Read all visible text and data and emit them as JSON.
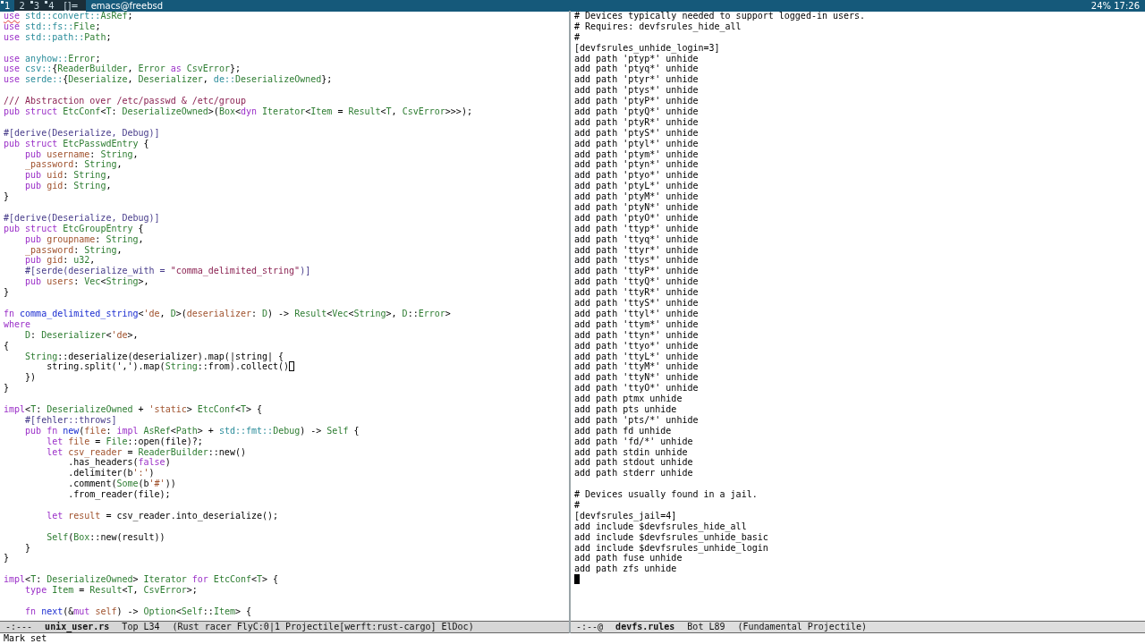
{
  "top_bar": {
    "tags": [
      {
        "label": "1",
        "selected": true,
        "occupied": true
      },
      {
        "label": "2",
        "selected": false,
        "occupied": false
      },
      {
        "label": "3",
        "selected": false,
        "occupied": true
      },
      {
        "label": "4",
        "selected": false,
        "occupied": true
      }
    ],
    "layout": "[]=",
    "window_title": "emacs@freebsd",
    "status": "24% 17:26"
  },
  "left_pane": {
    "active": false,
    "blocks": [
      [
        [
          {
            "kind": "flagged",
            "text": "use"
          },
          {
            "kind": "path",
            "text": " std::convert::"
          },
          {
            "kind": "type",
            "text": "AsRef"
          },
          {
            "kind": "plain",
            "text": ";"
          }
        ],
        [
          {
            "kind": "keyword",
            "text": "use "
          },
          {
            "kind": "path",
            "text": "std::fs::"
          },
          {
            "kind": "type",
            "text": "File"
          },
          {
            "kind": "plain",
            "text": ";"
          }
        ],
        [
          {
            "kind": "keyword",
            "text": "use "
          },
          {
            "kind": "path",
            "text": "std::path::"
          },
          {
            "kind": "type",
            "text": "Path"
          },
          {
            "kind": "plain",
            "text": ";"
          }
        ]
      ],
      [
        [
          {
            "kind": "keyword",
            "text": "use "
          },
          {
            "kind": "path",
            "text": "anyhow::"
          },
          {
            "kind": "type",
            "text": "Error"
          },
          {
            "kind": "plain",
            "text": ";"
          }
        ],
        [
          {
            "kind": "keyword",
            "text": "use "
          },
          {
            "kind": "path",
            "text": "csv::"
          },
          {
            "kind": "plain",
            "text": "{"
          },
          {
            "kind": "type",
            "text": "ReaderBuilder"
          },
          {
            "kind": "plain",
            "text": ", "
          },
          {
            "kind": "type",
            "text": "Error"
          },
          {
            "kind": "keyword",
            "text": " as "
          },
          {
            "kind": "type",
            "text": "CsvError"
          },
          {
            "kind": "plain",
            "text": "};"
          }
        ],
        [
          {
            "kind": "keyword",
            "text": "use "
          },
          {
            "kind": "path",
            "text": "serde::"
          },
          {
            "kind": "plain",
            "text": "{"
          },
          {
            "kind": "type",
            "text": "Deserialize"
          },
          {
            "kind": "plain",
            "text": ", "
          },
          {
            "kind": "type",
            "text": "Deserializer"
          },
          {
            "kind": "plain",
            "text": ", "
          },
          {
            "kind": "path",
            "text": "de::"
          },
          {
            "kind": "type",
            "text": "DeserializeOwned"
          },
          {
            "kind": "plain",
            "text": "};"
          }
        ]
      ],
      [
        [
          {
            "kind": "comment",
            "text": "/// Abstraction over /etc/passwd & /etc/group"
          }
        ],
        [
          {
            "kind": "keyword",
            "text": "pub struct "
          },
          {
            "kind": "type",
            "text": "EtcConf"
          },
          {
            "kind": "plain",
            "text": "<"
          },
          {
            "kind": "type",
            "text": "T"
          },
          {
            "kind": "plain",
            "text": ": "
          },
          {
            "kind": "type",
            "text": "DeserializeOwned"
          },
          {
            "kind": "plain",
            "text": ">("
          },
          {
            "kind": "type",
            "text": "Box"
          },
          {
            "kind": "plain",
            "text": "<"
          },
          {
            "kind": "keyword",
            "text": "dyn "
          },
          {
            "kind": "type",
            "text": "Iterator"
          },
          {
            "kind": "plain",
            "text": "<"
          },
          {
            "kind": "type",
            "text": "Item"
          },
          {
            "kind": "plain",
            "text": " = "
          },
          {
            "kind": "type",
            "text": "Result"
          },
          {
            "kind": "plain",
            "text": "<"
          },
          {
            "kind": "type",
            "text": "T"
          },
          {
            "kind": "plain",
            "text": ", "
          },
          {
            "kind": "type",
            "text": "CsvError"
          },
          {
            "kind": "plain",
            "text": ">>>);"
          }
        ]
      ],
      [
        [
          {
            "kind": "attribute",
            "text": "#[derive(Deserialize, Debug)]"
          }
        ],
        [
          {
            "kind": "keyword",
            "text": "pub struct "
          },
          {
            "kind": "type",
            "text": "EtcPasswdEntry"
          },
          {
            "kind": "plain",
            "text": " {"
          }
        ],
        [
          {
            "kind": "keyword",
            "text": "    pub "
          },
          {
            "kind": "variable",
            "text": "username"
          },
          {
            "kind": "plain",
            "text": ": "
          },
          {
            "kind": "type",
            "text": "String"
          },
          {
            "kind": "plain",
            "text": ","
          }
        ],
        [
          {
            "kind": "variable",
            "text": "    _password"
          },
          {
            "kind": "plain",
            "text": ": "
          },
          {
            "kind": "type",
            "text": "String"
          },
          {
            "kind": "plain",
            "text": ","
          }
        ],
        [
          {
            "kind": "keyword",
            "text": "    pub "
          },
          {
            "kind": "variable",
            "text": "uid"
          },
          {
            "kind": "plain",
            "text": ": "
          },
          {
            "kind": "type",
            "text": "String"
          },
          {
            "kind": "plain",
            "text": ","
          }
        ],
        [
          {
            "kind": "keyword",
            "text": "    pub "
          },
          {
            "kind": "variable",
            "text": "gid"
          },
          {
            "kind": "plain",
            "text": ": "
          },
          {
            "kind": "type",
            "text": "String"
          },
          {
            "kind": "plain",
            "text": ","
          }
        ],
        [
          {
            "kind": "plain",
            "text": "}"
          }
        ]
      ],
      [
        [
          {
            "kind": "attribute",
            "text": "#[derive(Deserialize, Debug)]"
          }
        ],
        [
          {
            "kind": "keyword",
            "text": "pub struct "
          },
          {
            "kind": "type",
            "text": "EtcGroupEntry"
          },
          {
            "kind": "plain",
            "text": " {"
          }
        ],
        [
          {
            "kind": "keyword",
            "text": "    pub "
          },
          {
            "kind": "variable",
            "text": "groupname"
          },
          {
            "kind": "plain",
            "text": ": "
          },
          {
            "kind": "type",
            "text": "String"
          },
          {
            "kind": "plain",
            "text": ","
          }
        ],
        [
          {
            "kind": "variable",
            "text": "    _password"
          },
          {
            "kind": "plain",
            "text": ": "
          },
          {
            "kind": "type",
            "text": "String"
          },
          {
            "kind": "plain",
            "text": ","
          }
        ],
        [
          {
            "kind": "keyword",
            "text": "    pub "
          },
          {
            "kind": "variable",
            "text": "gid"
          },
          {
            "kind": "plain",
            "text": ": "
          },
          {
            "kind": "type",
            "text": "u32"
          },
          {
            "kind": "plain",
            "text": ","
          }
        ],
        [
          {
            "kind": "attribute",
            "text": "    #[serde(deserialize_with = "
          },
          {
            "kind": "string",
            "text": "\"comma_delimited_string\""
          },
          {
            "kind": "attribute",
            "text": ")]"
          }
        ],
        [
          {
            "kind": "keyword",
            "text": "    pub "
          },
          {
            "kind": "variable",
            "text": "users"
          },
          {
            "kind": "plain",
            "text": ": "
          },
          {
            "kind": "type",
            "text": "Vec"
          },
          {
            "kind": "plain",
            "text": "<"
          },
          {
            "kind": "type",
            "text": "String"
          },
          {
            "kind": "plain",
            "text": ">,"
          }
        ],
        [
          {
            "kind": "plain",
            "text": "}"
          }
        ]
      ],
      [
        [
          {
            "kind": "keyword",
            "text": "fn "
          },
          {
            "kind": "function",
            "text": "comma_delimited_string"
          },
          {
            "kind": "plain",
            "text": "<"
          },
          {
            "kind": "variable",
            "text": "'de"
          },
          {
            "kind": "plain",
            "text": ", "
          },
          {
            "kind": "type",
            "text": "D"
          },
          {
            "kind": "plain",
            "text": ">("
          },
          {
            "kind": "variable",
            "text": "deserializer"
          },
          {
            "kind": "plain",
            "text": ": "
          },
          {
            "kind": "type",
            "text": "D"
          },
          {
            "kind": "plain",
            "text": ") -> "
          },
          {
            "kind": "type",
            "text": "Result"
          },
          {
            "kind": "plain",
            "text": "<"
          },
          {
            "kind": "type",
            "text": "Vec"
          },
          {
            "kind": "plain",
            "text": "<"
          },
          {
            "kind": "type",
            "text": "String"
          },
          {
            "kind": "plain",
            "text": ">, "
          },
          {
            "kind": "type",
            "text": "D"
          },
          {
            "kind": "plain",
            "text": "::"
          },
          {
            "kind": "type",
            "text": "Error"
          },
          {
            "kind": "plain",
            "text": ">"
          }
        ],
        [
          {
            "kind": "keyword",
            "text": "where"
          }
        ],
        [
          {
            "kind": "type",
            "text": "    D"
          },
          {
            "kind": "plain",
            "text": ": "
          },
          {
            "kind": "type",
            "text": "Deserializer"
          },
          {
            "kind": "plain",
            "text": "<"
          },
          {
            "kind": "variable",
            "text": "'de"
          },
          {
            "kind": "plain",
            "text": ">,"
          }
        ],
        [
          {
            "kind": "plain",
            "text": "{"
          }
        ],
        [
          {
            "kind": "type",
            "text": "    String"
          },
          {
            "kind": "plain",
            "text": "::deserialize(deserializer).map(|string| {"
          }
        ],
        [
          {
            "kind": "plain",
            "text": "        string.split(',').map("
          },
          {
            "kind": "type",
            "text": "String"
          },
          {
            "kind": "plain",
            "text": "::from).collect()"
          },
          {
            "kind": "cursor"
          }
        ],
        [
          {
            "kind": "plain",
            "text": "    })"
          }
        ],
        [
          {
            "kind": "plain",
            "text": "}"
          }
        ]
      ],
      [
        [
          {
            "kind": "keyword",
            "text": "impl"
          },
          {
            "kind": "plain",
            "text": "<"
          },
          {
            "kind": "type",
            "text": "T"
          },
          {
            "kind": "plain",
            "text": ": "
          },
          {
            "kind": "type",
            "text": "DeserializeOwned"
          },
          {
            "kind": "plain",
            "text": " + "
          },
          {
            "kind": "variable",
            "text": "'static"
          },
          {
            "kind": "plain",
            "text": "> "
          },
          {
            "kind": "type",
            "text": "EtcConf"
          },
          {
            "kind": "plain",
            "text": "<"
          },
          {
            "kind": "type",
            "text": "T"
          },
          {
            "kind": "plain",
            "text": "> {"
          }
        ],
        [
          {
            "kind": "attribute",
            "text": "    #[fehler::throws]"
          }
        ],
        [
          {
            "kind": "keyword",
            "text": "    pub fn "
          },
          {
            "kind": "function",
            "text": "new"
          },
          {
            "kind": "plain",
            "text": "("
          },
          {
            "kind": "variable",
            "text": "file"
          },
          {
            "kind": "plain",
            "text": ": "
          },
          {
            "kind": "keyword",
            "text": "impl "
          },
          {
            "kind": "type",
            "text": "AsRef"
          },
          {
            "kind": "plain",
            "text": "<"
          },
          {
            "kind": "type",
            "text": "Path"
          },
          {
            "kind": "plain",
            "text": "> + "
          },
          {
            "kind": "path",
            "text": "std::fmt::"
          },
          {
            "kind": "type",
            "text": "Debug"
          },
          {
            "kind": "plain",
            "text": ") -> "
          },
          {
            "kind": "type",
            "text": "Self"
          },
          {
            "kind": "plain",
            "text": " {"
          }
        ],
        [
          {
            "kind": "keyword",
            "text": "        let "
          },
          {
            "kind": "variable",
            "text": "file"
          },
          {
            "kind": "plain",
            "text": " = "
          },
          {
            "kind": "type",
            "text": "File"
          },
          {
            "kind": "plain",
            "text": "::open(file)?;"
          }
        ],
        [
          {
            "kind": "keyword",
            "text": "        let "
          },
          {
            "kind": "variable",
            "text": "csv_reader"
          },
          {
            "kind": "plain",
            "text": " = "
          },
          {
            "kind": "type",
            "text": "ReaderBuilder"
          },
          {
            "kind": "plain",
            "text": "::new()"
          }
        ],
        [
          {
            "kind": "plain",
            "text": "            .has_headers("
          },
          {
            "kind": "keyword",
            "text": "false"
          },
          {
            "kind": "plain",
            "text": ")"
          }
        ],
        [
          {
            "kind": "plain",
            "text": "            .delimiter(b"
          },
          {
            "kind": "variable",
            "text": "':'"
          },
          {
            "kind": "plain",
            "text": ")"
          }
        ],
        [
          {
            "kind": "plain",
            "text": "            .comment("
          },
          {
            "kind": "type",
            "text": "Some"
          },
          {
            "kind": "plain",
            "text": "(b"
          },
          {
            "kind": "variable",
            "text": "'#'"
          },
          {
            "kind": "plain",
            "text": "))"
          }
        ],
        [
          {
            "kind": "plain",
            "text": "            .from_reader(file);"
          }
        ]
      ],
      [
        [
          {
            "kind": "keyword",
            "text": "        let "
          },
          {
            "kind": "variable",
            "text": "result"
          },
          {
            "kind": "plain",
            "text": " = csv_reader.into_deserialize();"
          }
        ]
      ],
      [
        [
          {
            "kind": "type",
            "text": "        Self"
          },
          {
            "kind": "plain",
            "text": "("
          },
          {
            "kind": "type",
            "text": "Box"
          },
          {
            "kind": "plain",
            "text": "::new(result))"
          }
        ],
        [
          {
            "kind": "plain",
            "text": "    }"
          }
        ],
        [
          {
            "kind": "plain",
            "text": "}"
          }
        ]
      ],
      [
        [
          {
            "kind": "keyword",
            "text": "impl"
          },
          {
            "kind": "plain",
            "text": "<"
          },
          {
            "kind": "type",
            "text": "T"
          },
          {
            "kind": "plain",
            "text": ": "
          },
          {
            "kind": "type",
            "text": "DeserializeOwned"
          },
          {
            "kind": "plain",
            "text": "> "
          },
          {
            "kind": "type",
            "text": "Iterator"
          },
          {
            "kind": "keyword",
            "text": " for "
          },
          {
            "kind": "type",
            "text": "EtcConf"
          },
          {
            "kind": "plain",
            "text": "<"
          },
          {
            "kind": "type",
            "text": "T"
          },
          {
            "kind": "plain",
            "text": "> {"
          }
        ],
        [
          {
            "kind": "keyword",
            "text": "    type "
          },
          {
            "kind": "type",
            "text": "Item"
          },
          {
            "kind": "plain",
            "text": " = "
          },
          {
            "kind": "type",
            "text": "Result"
          },
          {
            "kind": "plain",
            "text": "<"
          },
          {
            "kind": "type",
            "text": "T"
          },
          {
            "kind": "plain",
            "text": ", "
          },
          {
            "kind": "type",
            "text": "CsvError"
          },
          {
            "kind": "plain",
            "text": ">;"
          }
        ]
      ],
      [
        [
          {
            "kind": "keyword",
            "text": "    fn "
          },
          {
            "kind": "function",
            "text": "next"
          },
          {
            "kind": "plain",
            "text": "(&"
          },
          {
            "kind": "keyword",
            "text": "mut "
          },
          {
            "kind": "variable",
            "text": "self"
          },
          {
            "kind": "plain",
            "text": ") -> "
          },
          {
            "kind": "type",
            "text": "Option"
          },
          {
            "kind": "plain",
            "text": "<"
          },
          {
            "kind": "type",
            "text": "Self"
          },
          {
            "kind": "plain",
            "text": "::"
          },
          {
            "kind": "type",
            "text": "Item"
          },
          {
            "kind": "plain",
            "text": "> {"
          }
        ]
      ]
    ],
    "mode_line": {
      "flags": "-:---",
      "buffer": "unix_user.rs",
      "position": "Top L34",
      "modes": "(Rust racer FlyC:0|1 Projectile[werft:rust-cargo] ElDoc)"
    }
  },
  "right_pane": {
    "active": true,
    "cursor_at_end": true,
    "blocks": [
      [
        "# Devices typically needed to support logged-in users.",
        "# Requires: devfsrules_hide_all",
        "#",
        "[devfsrules_unhide_login=3]",
        "add path 'ptyp*' unhide",
        "add path 'ptyq*' unhide",
        "add path 'ptyr*' unhide",
        "add path 'ptys*' unhide",
        "add path 'ptyP*' unhide",
        "add path 'ptyQ*' unhide",
        "add path 'ptyR*' unhide",
        "add path 'ptyS*' unhide",
        "add path 'ptyl*' unhide",
        "add path 'ptym*' unhide",
        "add path 'ptyn*' unhide",
        "add path 'ptyo*' unhide",
        "add path 'ptyL*' unhide",
        "add path 'ptyM*' unhide",
        "add path 'ptyN*' unhide",
        "add path 'ptyO*' unhide",
        "add path 'ttyp*' unhide",
        "add path 'ttyq*' unhide",
        "add path 'ttyr*' unhide",
        "add path 'ttys*' unhide",
        "add path 'ttyP*' unhide",
        "add path 'ttyQ*' unhide",
        "add path 'ttyR*' unhide",
        "add path 'ttyS*' unhide",
        "add path 'ttyl*' unhide",
        "add path 'ttym*' unhide",
        "add path 'ttyn*' unhide",
        "add path 'ttyo*' unhide",
        "add path 'ttyL*' unhide",
        "add path 'ttyM*' unhide",
        "add path 'ttyN*' unhide",
        "add path 'ttyO*' unhide",
        "add path ptmx unhide",
        "add path pts unhide",
        "add path 'pts/*' unhide",
        "add path fd unhide",
        "add path 'fd/*' unhide",
        "add path stdin unhide",
        "add path stdout unhide",
        "add path stderr unhide"
      ],
      [
        "# Devices usually found in a jail.",
        "#",
        "[devfsrules_jail=4]",
        "add include $devfsrules_hide_all",
        "add include $devfsrules_unhide_basic",
        "add include $devfsrules_unhide_login",
        "add path fuse unhide",
        "add path zfs unhide"
      ]
    ],
    "mode_line": {
      "flags": "-:--@",
      "buffer": "devfs.rules",
      "position": "Bot L89",
      "modes": "(Fundamental Projectile)"
    }
  },
  "echo_area": "Mark set"
}
